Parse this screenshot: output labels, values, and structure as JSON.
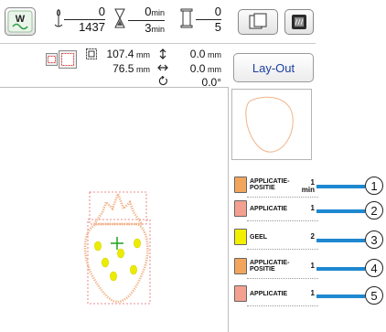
{
  "status": {
    "stitch_current": "0",
    "stitch_total": "1437",
    "time_current": "0",
    "time_current_unit": "min",
    "time_total": "3",
    "time_total_unit": "min",
    "color_current": "0",
    "color_total": "5"
  },
  "info": {
    "size_width": "107.4",
    "size_height": "76.5",
    "size_unit": "mm",
    "offset_v": "0.0",
    "offset_h": "0.0",
    "offset_unit": "mm",
    "rotation": "0.0°"
  },
  "buttons": {
    "layout_label": "Lay-Out"
  },
  "icons": {
    "thread_mode": "thread-w-icon",
    "stitch_count": "needle-icon",
    "time": "hourglass-icon",
    "color_changes": "thread-spool-icon",
    "frame_copy": "frame-copy-icon",
    "lcd_mode": "film-icon",
    "frame_size": "embroidery-frame-icon",
    "pattern_size": "size-icon",
    "vertical_offset": "vertical-arrows-icon",
    "horizontal_offset": "horizontal-arrows-icon",
    "rotation": "rotate-icon"
  },
  "threads": [
    {
      "label_line1": "APPLICATIE-",
      "label_line2": "POSITIE",
      "number": "1",
      "unit": "min",
      "color": "#f2a55c",
      "callout": "1"
    },
    {
      "label_line1": "APPLICATIE",
      "label_line2": "",
      "number": "1",
      "unit": "",
      "color": "#f4a090",
      "callout": "2"
    },
    {
      "label_line1": "GEEL",
      "label_line2": "",
      "number": "2",
      "unit": "",
      "color": "#f2ef00",
      "callout": "3"
    },
    {
      "label_line1": "APPLICATIE-",
      "label_line2": "POSITIE",
      "number": "1",
      "unit": "",
      "color": "#f2a55c",
      "callout": "4"
    },
    {
      "label_line1": "APPLICATIE",
      "label_line2": "",
      "number": "1",
      "unit": "",
      "color": "#f4a090",
      "callout": "5"
    }
  ],
  "colors": {
    "accent_blue": "#1e88d0",
    "stitch_outline": "#f1b48a",
    "seed_yellow": "#ecec00",
    "center_cross": "#1fa21f"
  }
}
